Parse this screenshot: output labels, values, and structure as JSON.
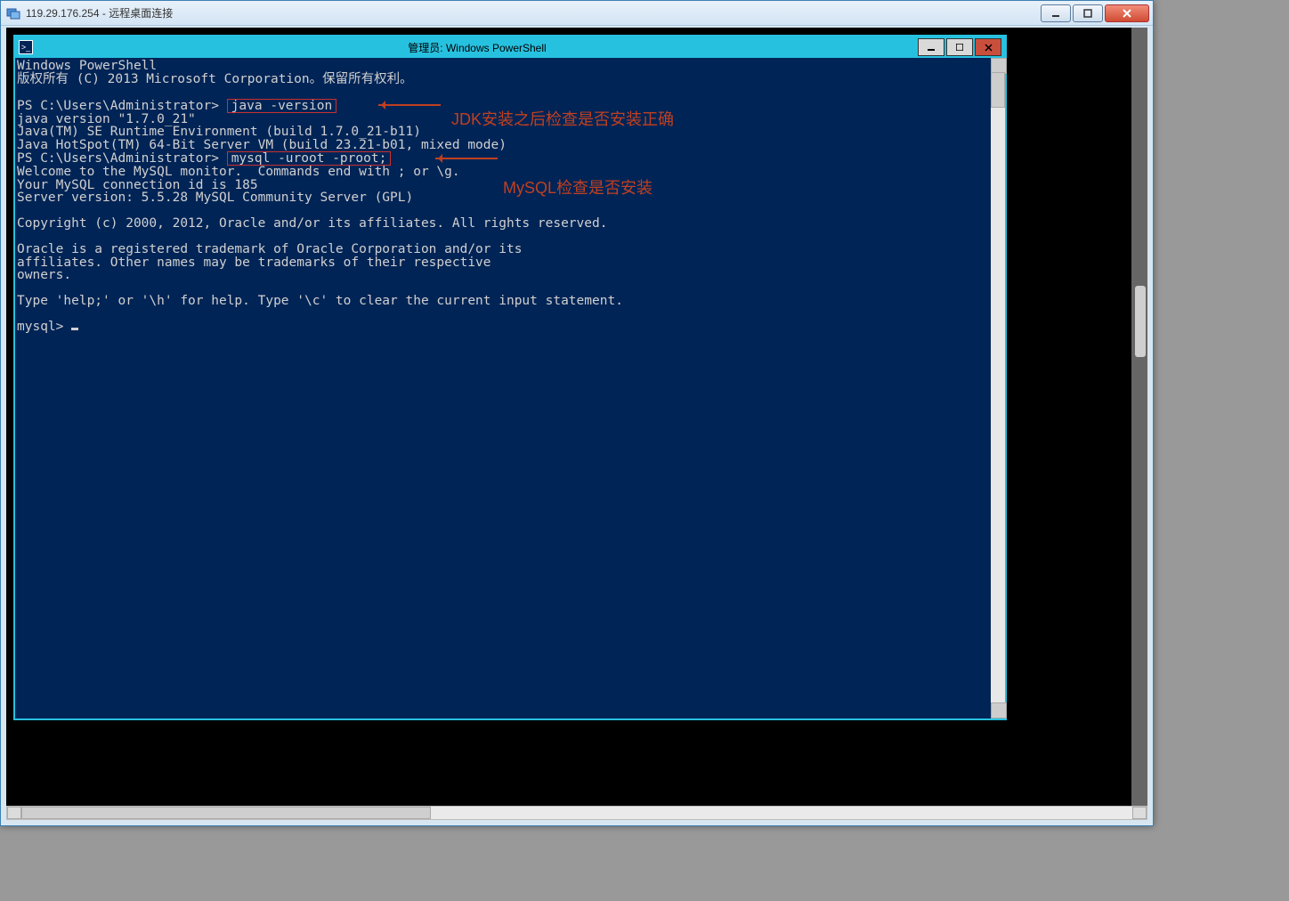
{
  "rdc": {
    "title": "119.29.176.254 - 远程桌面连接"
  },
  "ps": {
    "title": "管理员: Windows PowerShell"
  },
  "annotations": {
    "jdk": "JDK安装之后检查是否安装正确",
    "mysql": "MySQL检查是否安装"
  },
  "terminal": {
    "header1": "Windows PowerShell",
    "header2": "版权所有 (C) 2013 Microsoft Corporation。保留所有权利。",
    "prompt1": "PS C:\\Users\\Administrator> ",
    "cmd1": "java -version",
    "out1": "java version \"1.7.0_21\"",
    "out2": "Java(TM) SE Runtime Environment (build 1.7.0_21-b11)",
    "out3": "Java HotSpot(TM) 64-Bit Server VM (build 23.21-b01, mixed mode)",
    "prompt2": "PS C:\\Users\\Administrator> ",
    "cmd2": "mysql -uroot -proot;",
    "m1": "Welcome to the MySQL monitor.  Commands end with ; or \\g.",
    "m2": "Your MySQL connection id is 185",
    "m3": "Server version: 5.5.28 MySQL Community Server (GPL)",
    "m4": "Copyright (c) 2000, 2012, Oracle and/or its affiliates. All rights reserved.",
    "m5": "Oracle is a registered trademark of Oracle Corporation and/or its",
    "m6": "affiliates. Other names may be trademarks of their respective",
    "m7": "owners.",
    "m8": "Type 'help;' or '\\h' for help. Type '\\c' to clear the current input statement.",
    "mprompt": "mysql> "
  }
}
